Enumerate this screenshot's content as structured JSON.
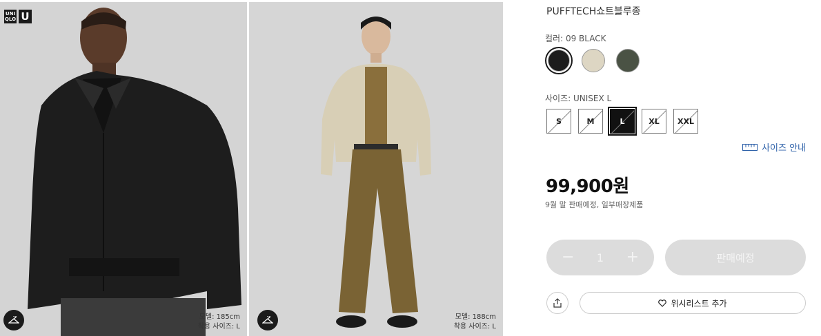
{
  "gallery": {
    "logo": {
      "uniqlo_text": "UNI QLO",
      "u_text": "U"
    },
    "photos": [
      {
        "subject": "model wearing black jacket",
        "model_height": "모델: 185cm",
        "size_worn": "착용 사이즈: L"
      },
      {
        "subject": "model wearing beige jacket and olive trousers",
        "model_height": "모델: 188cm",
        "size_worn": "착용 사이즈: L"
      }
    ],
    "hanger_icon": "hanger-icon"
  },
  "product": {
    "title": "PUFFTECH쇼트블루종",
    "color_label": "컬러: 09 BLACK",
    "colors": [
      {
        "name": "BLACK",
        "hex": "#1d1d1d",
        "selected": true
      },
      {
        "name": "BEIGE",
        "hex": "#ddd6c3",
        "selected": false
      },
      {
        "name": "OLIVE",
        "hex": "#4a5244",
        "selected": false
      }
    ],
    "size_label": "사이즈: UNISEX L",
    "sizes": [
      {
        "label": "S",
        "selected": false,
        "unavailable": true
      },
      {
        "label": "M",
        "selected": false,
        "unavailable": true
      },
      {
        "label": "L",
        "selected": true,
        "unavailable": true
      },
      {
        "label": "XL",
        "selected": false,
        "unavailable": true
      },
      {
        "label": "XXL",
        "selected": false,
        "unavailable": true
      }
    ],
    "size_guide_label": "사이즈 안내",
    "price": "99,900원",
    "sale_note": "9월 말 판매예정,  일부매장제품",
    "quantity": {
      "minus": "−",
      "value": "1",
      "plus": "+"
    },
    "buy_label": "판매예정",
    "wishlist_label": "위시리스트 추가"
  },
  "colors": {
    "link": "#2b5fa8",
    "disabled": "#dcdcdc",
    "dark": "#111111"
  }
}
